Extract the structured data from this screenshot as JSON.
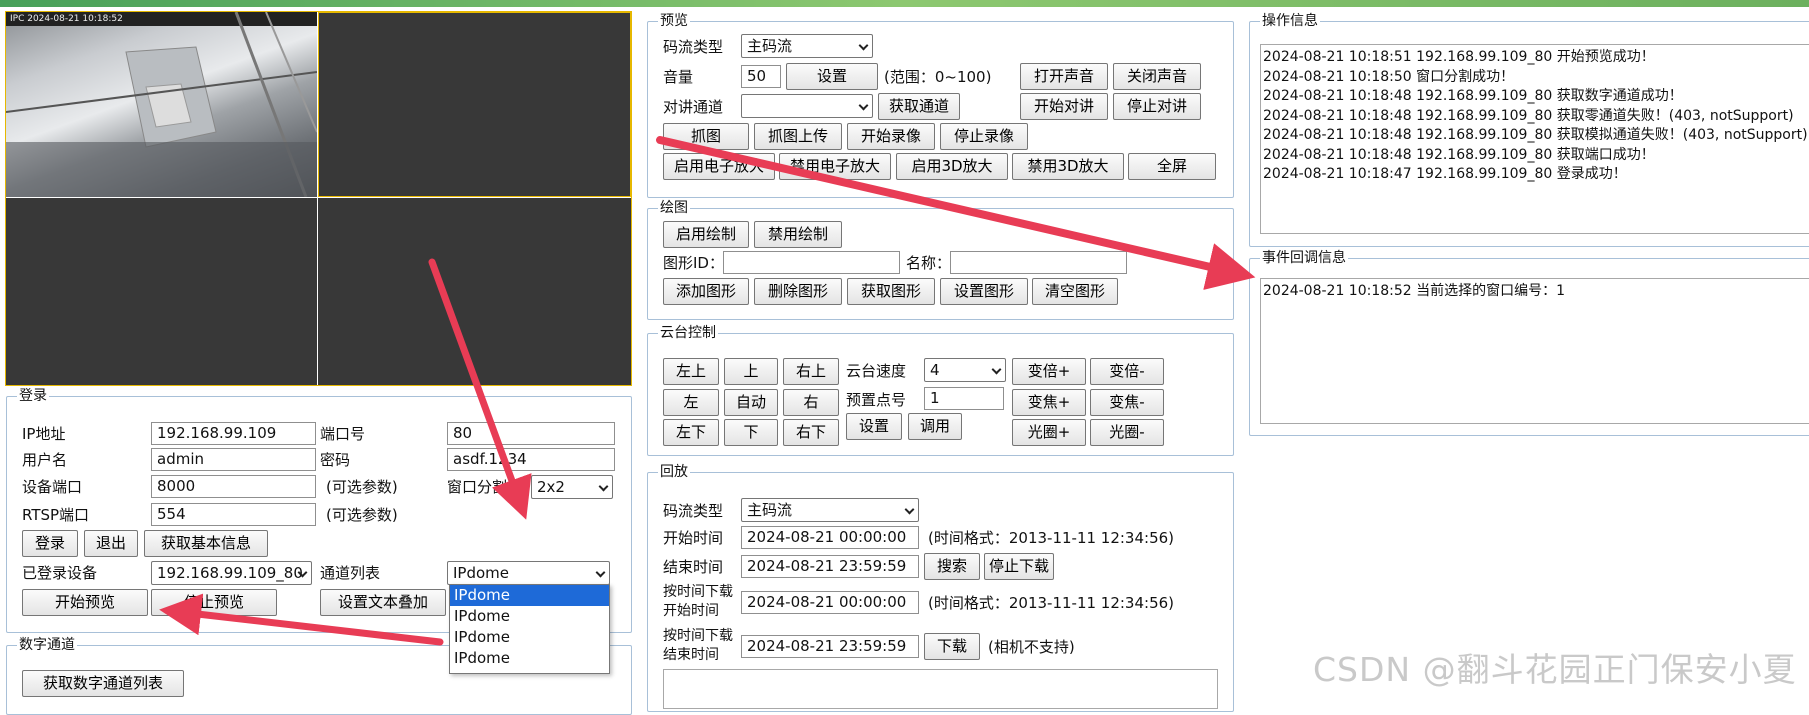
{
  "colors": {
    "accent": "#e83c55",
    "highlight": "#1e6ad8",
    "video_bg": "#383838",
    "active_window_border": "#e6b800"
  },
  "video": {
    "overlay_text": "IPC  2024-08-21  10:18:52"
  },
  "login": {
    "legend": "登录",
    "ip_label": "IP地址",
    "ip_value": "192.168.99.109",
    "port_label": "端口号",
    "port_value": "80",
    "user_label": "用户名",
    "user_value": "admin",
    "pwd_label": "密码",
    "pwd_value": "asdf.1234",
    "dev_port_label": "设备端口",
    "dev_port_value": "8000",
    "optional_1": "(可选参数)",
    "split_label": "窗口分割数",
    "split_value": "2x2",
    "rtsp_label": "RTSP端口",
    "rtsp_value": "554",
    "optional_2": "(可选参数)",
    "login_btn": "登录",
    "logout_btn": "退出",
    "basic_info_btn": "获取基本信息",
    "logged_label": "已登录设备",
    "logged_value": "192.168.99.109_80",
    "channel_label": "通道列表",
    "channel_value": "IPdome",
    "channel_options": [
      "IPdome",
      "IPdome",
      "IPdome",
      "IPdome"
    ],
    "start_preview_btn": "开始预览",
    "stop_preview_btn": "停止预览",
    "text_overlay_btn": "设置文本叠加"
  },
  "digital": {
    "legend": "数字通道",
    "get_list_btn": "获取数字通道列表"
  },
  "preview": {
    "legend": "预览",
    "stream_label": "码流类型",
    "stream_value": "主码流",
    "volume_label": "音量",
    "volume_value": "50",
    "set_btn": "设置",
    "range_text": "(范围：0~100)",
    "open_sound_btn": "打开声音",
    "close_sound_btn": "关闭声音",
    "talk_label": "对讲通道",
    "get_channel_btn": "获取通道",
    "start_talk_btn": "开始对讲",
    "stop_talk_btn": "停止对讲",
    "capture_btn": "抓图",
    "capture_upload_btn": "抓图上传",
    "start_record_btn": "开始录像",
    "stop_record_btn": "停止录像",
    "ezoom_on_btn": "启用电子放大",
    "ezoom_off_btn": "禁用电子放大",
    "zoom3d_on_btn": "启用3D放大",
    "zoom3d_off_btn": "禁用3D放大",
    "fullscreen_btn": "全屏"
  },
  "draw": {
    "legend": "绘图",
    "enable_btn": "启用绘制",
    "disable_btn": "禁用绘制",
    "shape_id_label": "图形ID：",
    "name_label": "名称：",
    "add_btn": "添加图形",
    "delete_btn": "删除图形",
    "get_btn": "获取图形",
    "set_btn": "设置图形",
    "clear_btn": "清空图形"
  },
  "ptz": {
    "legend": "云台控制",
    "upleft": "左上",
    "up": "上",
    "upright": "右上",
    "left": "左",
    "auto": "自动",
    "right": "右",
    "downleft": "左下",
    "down": "下",
    "downright": "右下",
    "speed_label": "云台速度",
    "speed_value": "4",
    "preset_label": "预置点号",
    "preset_value": "1",
    "set_btn": "设置",
    "call_btn": "调用",
    "zoom_in": "变倍+",
    "zoom_out": "变倍-",
    "focus_in": "变焦+",
    "focus_out": "变焦-",
    "iris_in": "光圈+",
    "iris_out": "光圈-"
  },
  "playback": {
    "legend": "回放",
    "stream_label": "码流类型",
    "stream_value": "主码流",
    "start_label": "开始时间",
    "start_value": "2024-08-21 00:00:00",
    "format_1": "(时间格式：2013-11-11 12:34:56)",
    "end_label": "结束时间",
    "end_value": "2024-08-21 23:59:59",
    "search_btn": "搜索",
    "stop_download_btn": "停止下载",
    "dl_start_label_1": "按时间下载",
    "dl_start_label_2": "开始时间",
    "dl_start_value": "2024-08-21 00:00:00",
    "format_2": "(时间格式：2013-11-11 12:34:56)",
    "dl_end_label_1": "按时间下载",
    "dl_end_label_2": "结束时间",
    "dl_end_value": "2024-08-21 23:59:59",
    "download_btn": "下载",
    "unsupported": "(相机不支持)"
  },
  "op_info": {
    "legend": "操作信息",
    "lines": [
      "2024-08-21 10:18:51 192.168.99.109_80 开始预览成功！",
      "2024-08-21 10:18:50 窗口分割成功！",
      "2024-08-21 10:18:48 192.168.99.109_80 获取数字通道成功！",
      "2024-08-21 10:18:48 192.168.99.109_80 获取零通道失败！(403, notSupport)",
      "2024-08-21 10:18:48 192.168.99.109_80 获取模拟通道失败！(403, notSupport)",
      "2024-08-21 10:18:48 192.168.99.109_80 获取端口成功！",
      "2024-08-21 10:18:47 192.168.99.109_80 登录成功！"
    ]
  },
  "event_info": {
    "legend": "事件回调信息",
    "lines": [
      "2024-08-21 10:18:52 当前选择的窗口编号：1"
    ]
  },
  "watermark": "CSDN @翻斗花园正门保安小夏"
}
